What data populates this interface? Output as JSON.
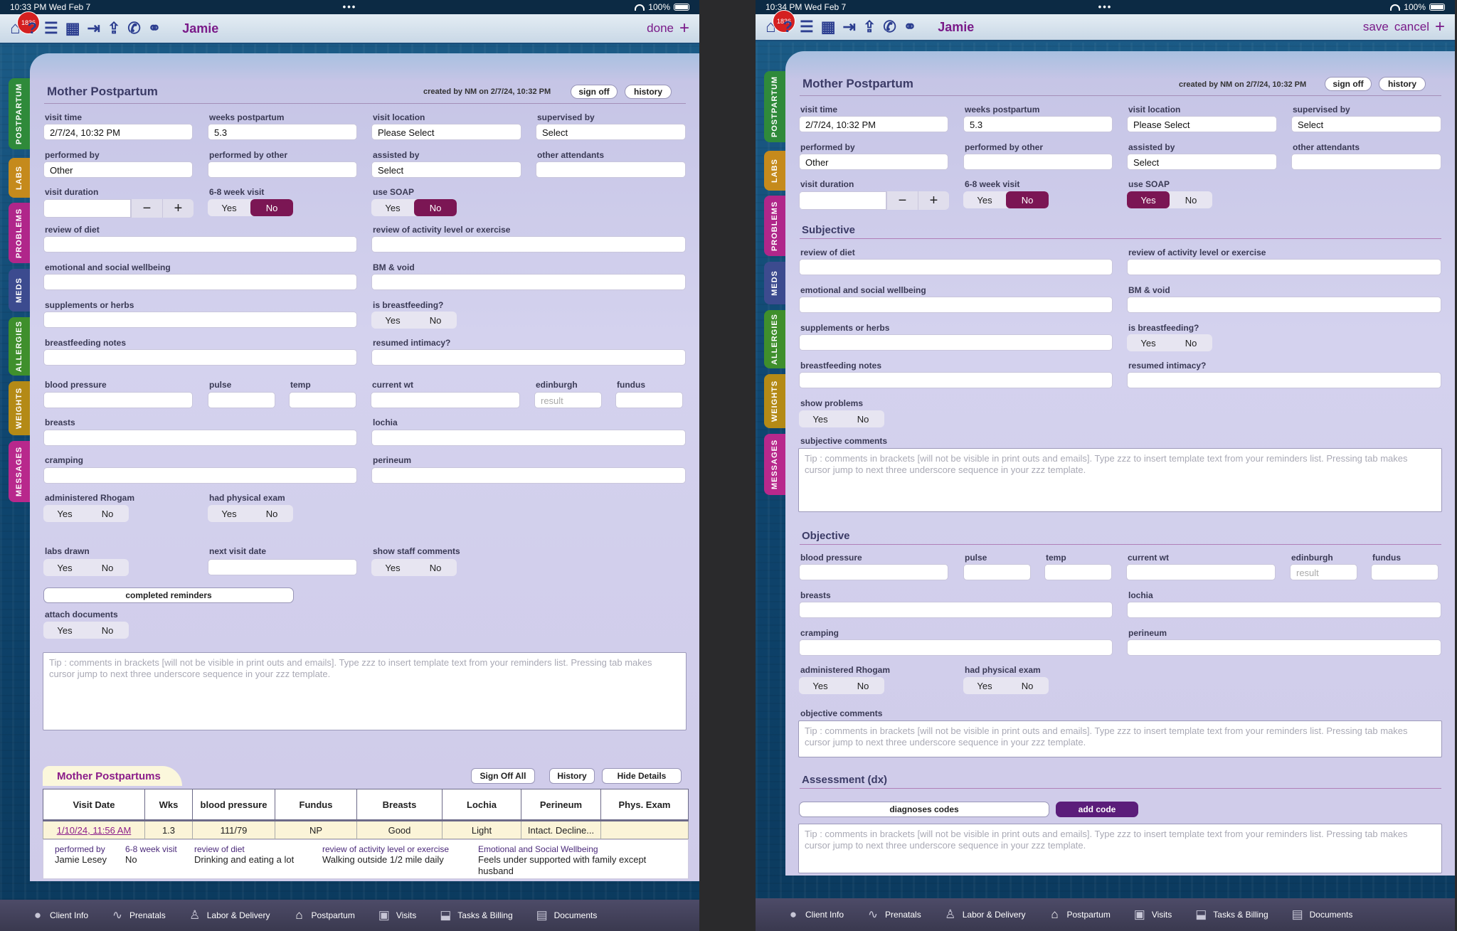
{
  "left": {
    "status": {
      "time": "10:33 PM  Wed Feb 7",
      "dots": "•••",
      "battery": "100%"
    },
    "topbar": {
      "badge": "1836",
      "name": "Jamie",
      "action": "done",
      "plus": "+"
    },
    "sidetabs": [
      "POSTPARTUM",
      "LABS",
      "PROBLEMS",
      "MEDS",
      "ALLERGIES",
      "WEIGHTS",
      "MESSAGES"
    ],
    "title": "Mother Postpartum",
    "created_by": "created by NM on 2/7/24, 10:32 PM",
    "sign_off": "sign off",
    "history": "history",
    "labels": {
      "visit_time": "visit time",
      "weeks_postpartum": "weeks postpartum",
      "visit_location": "visit location",
      "supervised_by": "supervised by",
      "performed_by": "performed by",
      "performed_by_other": "performed by other",
      "assisted_by": "assisted by",
      "other_attendants": "other attendants",
      "visit_duration": "visit duration",
      "six_eight": "6-8 week visit",
      "use_soap": "use SOAP",
      "review_diet": "review of diet",
      "review_activity": "review of activity level or exercise",
      "emotional": "emotional and social wellbeing",
      "bm_void": "BM & void",
      "supplements": "supplements or herbs",
      "is_breastfeeding": "is breastfeeding?",
      "breastfeeding_notes": "breastfeeding notes",
      "resumed_intimacy": "resumed intimacy?",
      "blood_pressure": "blood pressure",
      "pulse": "pulse",
      "temp": "temp",
      "current_wt": "current wt",
      "edinburgh": "edinburgh",
      "fundus": "fundus",
      "breasts": "breasts",
      "lochia": "lochia",
      "cramping": "cramping",
      "perineum": "perineum",
      "rhogam": "administered Rhogam",
      "physical_exam": "had physical exam",
      "labs_drawn": "labs drawn",
      "next_visit_date": "next visit date",
      "show_staff_comments": "show staff comments",
      "attach_documents": "attach documents"
    },
    "values": {
      "visit_time": "2/7/24, 10:32 PM",
      "weeks_postpartum": "5.3",
      "visit_location": "Please Select",
      "supervised_by": "Select",
      "performed_by": "Other",
      "assisted_by": "Select",
      "edinburgh_placeholder": "result"
    },
    "yes": "Yes",
    "no": "No",
    "minus": "−",
    "plus": "+",
    "completed_reminders": "completed reminders",
    "tip": "Tip : comments in brackets [will not be visible in print outs and emails].  Type zzz to insert template text from your reminders list. Pressing tab makes cursor jump to next three underscore sequence in your zzz template.",
    "lower": {
      "tab": "Mother Postpartums",
      "sign_off_all": "Sign Off All",
      "history": "History",
      "hide_details": "Hide Details",
      "headers": [
        "Visit Date",
        "Wks",
        "blood pressure",
        "Fundus",
        "Breasts",
        "Lochia",
        "Perineum",
        "Phys. Exam"
      ],
      "row": [
        "1/10/24, 11:56 AM",
        "1.3",
        "111/79",
        "NP",
        "Good",
        "Light",
        "Intact. Decline...",
        ""
      ],
      "details": [
        {
          "k": "performed by",
          "v": "Jamie Lesey"
        },
        {
          "k": "6-8 week visit",
          "v": "No"
        },
        {
          "k": "review of diet",
          "v": "Drinking  and eating a lot"
        },
        {
          "k": "review of activity level or exercise",
          "v": "Walking outside 1/2 mile daily"
        },
        {
          "k": "Emotional and Social Wellbeing",
          "v": "Feels under supported with family except husband"
        }
      ]
    },
    "nav": [
      "Client Info",
      "Prenatals",
      "Labor & Delivery",
      "Postpartum",
      "Visits",
      "Tasks & Billing",
      "Documents"
    ]
  },
  "right": {
    "status": {
      "time": "10:34 PM  Wed Feb 7",
      "battery": "100%"
    },
    "topbar": {
      "name": "Jamie",
      "save": "save",
      "cancel": "cancel"
    },
    "sections": {
      "subjective": "Subjective",
      "objective": "Objective",
      "assessment": "Assessment (dx)"
    },
    "labels": {
      "show_problems": "show problems",
      "subjective_comments": "subjective comments",
      "objective_comments": "objective comments"
    },
    "diagnoses_codes": "diagnoses codes",
    "add_code": "add code"
  },
  "colors": {
    "accent": "#7a1b89",
    "selected": "#7b1654",
    "navbar": "#3a394f"
  }
}
